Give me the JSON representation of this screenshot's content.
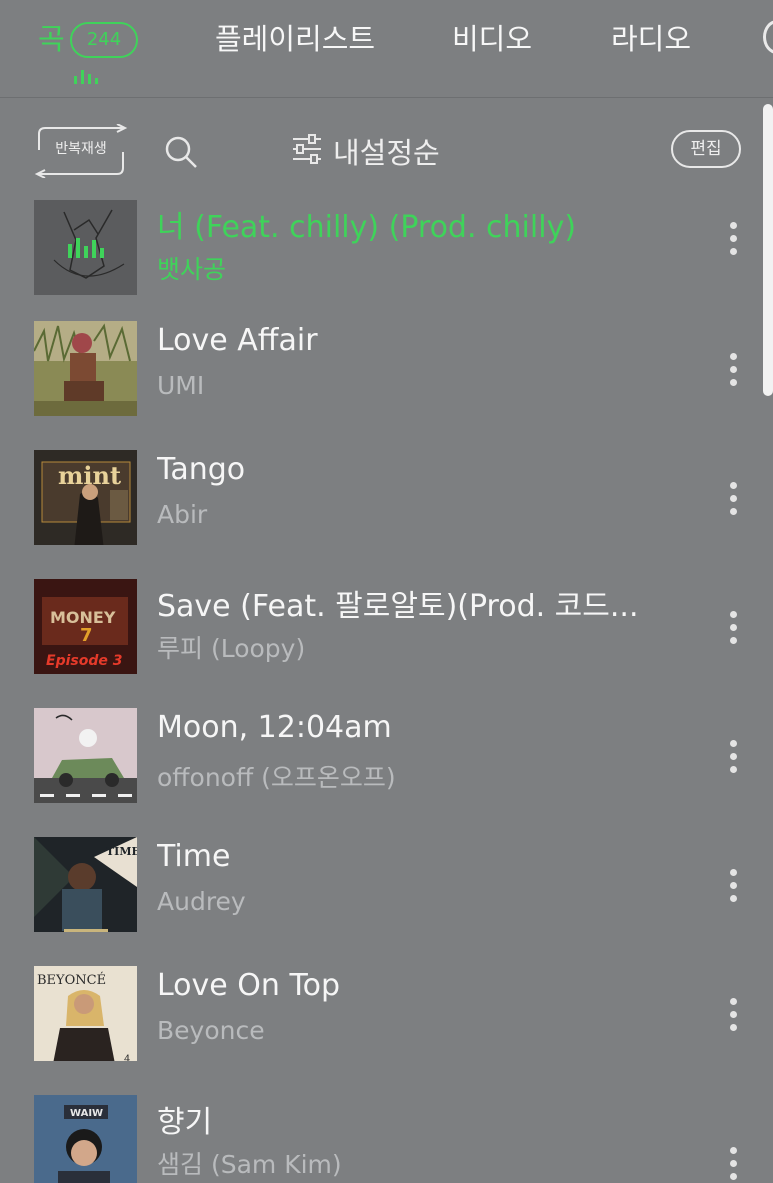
{
  "tabs": {
    "songs": "곡",
    "songs_count": "244",
    "playlist": "플레이리스트",
    "video": "비디오",
    "radio": "라디오"
  },
  "toolbar": {
    "repeat_label": "반복재생",
    "sort_label": "내설정순",
    "edit_label": "편집"
  },
  "colors": {
    "accent": "#3fd35a",
    "background": "#7d7f81",
    "text_primary": "#f6f6f6",
    "text_secondary": "#b9bbbd"
  },
  "songs": [
    {
      "title": "너 (Feat. chilly) (Prod. chilly)",
      "artist": "뱃사공",
      "playing": true
    },
    {
      "title": "Love Affair",
      "artist": "UMI",
      "playing": false
    },
    {
      "title": "Tango",
      "artist": "Abir",
      "playing": false
    },
    {
      "title": "Save (Feat. 팔로알토)(Prod. 코드...",
      "artist": "루피 (Loopy)",
      "playing": false
    },
    {
      "title": "Moon, 12:04am",
      "artist": "offonoff (오프온오프)",
      "playing": false
    },
    {
      "title": "Time",
      "artist": "Audrey",
      "playing": false
    },
    {
      "title": "Love On Top",
      "artist": "Beyonce",
      "playing": false
    },
    {
      "title": "향기",
      "artist": "샘김 (Sam Kim)",
      "playing": false
    }
  ],
  "covers": {
    "tango_text": "mint",
    "save_text": "Episode 3",
    "save_top": "MONEY",
    "time_text": "TIME",
    "beyonce_text": "BEYONCÉ",
    "beyonce_number": "4",
    "hyanggi_text": "WAIW"
  }
}
